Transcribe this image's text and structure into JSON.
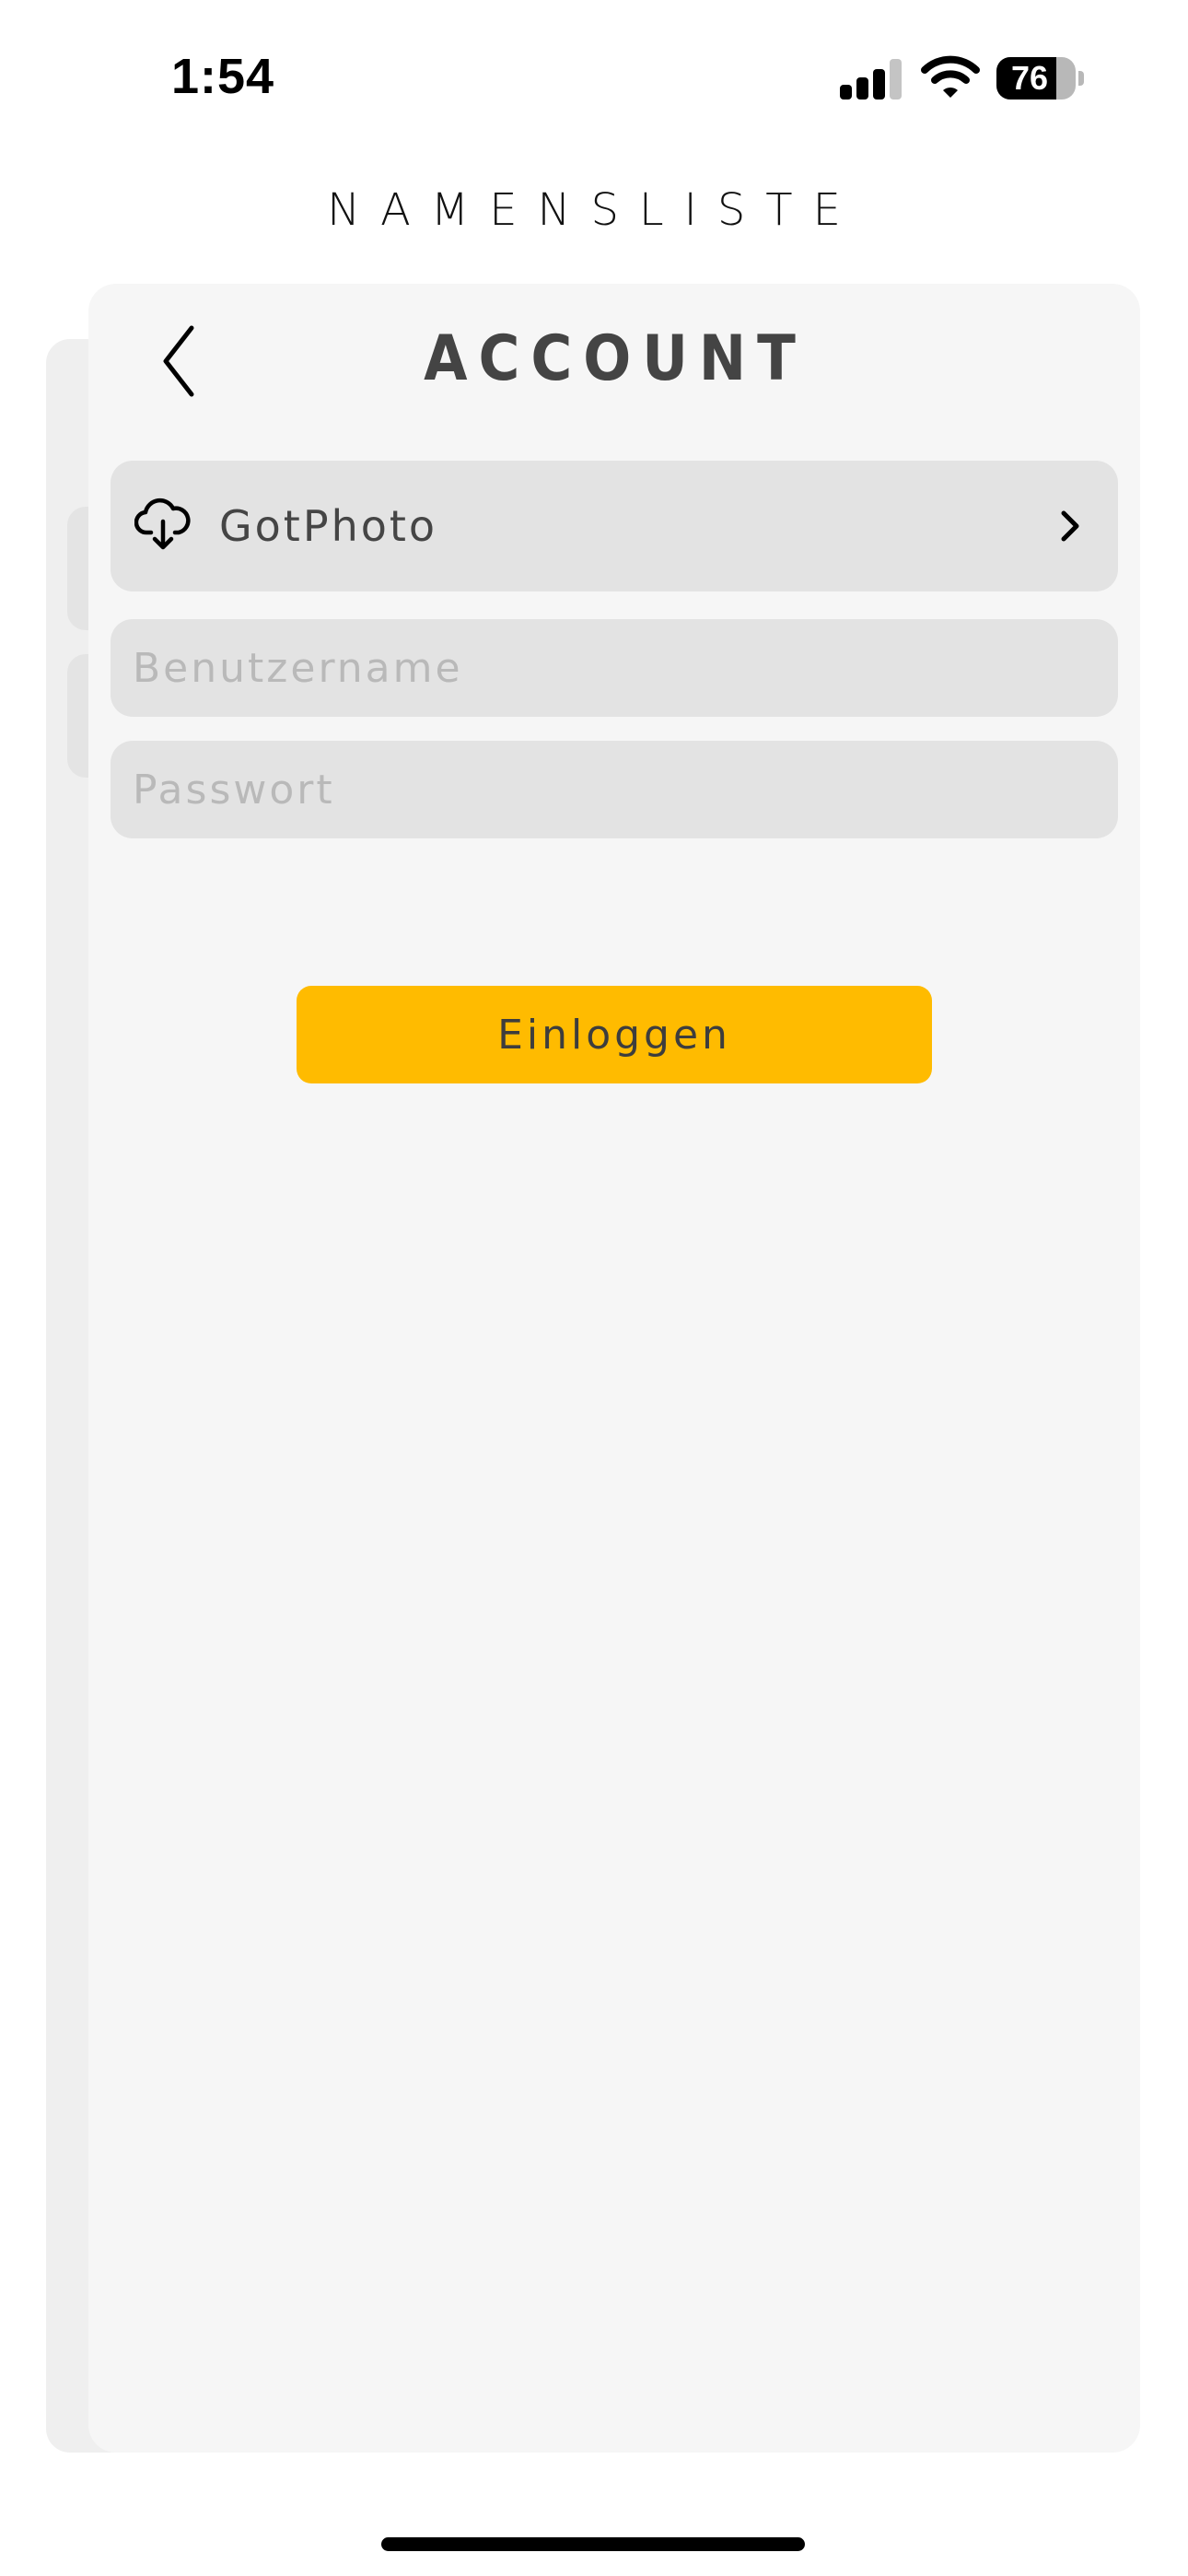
{
  "status_bar": {
    "time": "1:54",
    "battery_level": "76",
    "battery_fraction": 0.76,
    "signal_bars_active": 3,
    "signal_bars_total": 4
  },
  "header": {
    "title": "NAMENSLISTE"
  },
  "sheet": {
    "title": "ACCOUNT",
    "provider": {
      "label": "GotPhoto",
      "icon": "cloud-download-icon"
    },
    "username": {
      "value": "",
      "placeholder": "Benutzername"
    },
    "password": {
      "value": "",
      "placeholder": "Passwort"
    },
    "login_label": "Einloggen"
  },
  "colors": {
    "accent": "#ffbb00",
    "sheet_background": "#f6f6f6",
    "field_background": "#e3e3e3",
    "text": "#454545",
    "placeholder": "#b9b9b9"
  }
}
